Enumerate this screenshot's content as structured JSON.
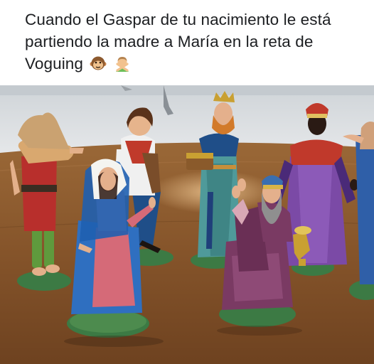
{
  "post": {
    "caption": "Cuando el Gaspar de tu nacimiento le está partiendo la madre a María en la reta de Voguing",
    "caption_emojis": [
      "monkey-face-emoji",
      "man-gesturing-no-emoji"
    ]
  },
  "photo": {
    "subject": "nativity-figurines",
    "figures": [
      "shepherd-with-lamb",
      "shepherd-boy",
      "virgin-mary",
      "king-melchior",
      "king-gaspar",
      "king-baltasar"
    ]
  },
  "colors": {
    "caption_text": "#1c1e21",
    "table": "#8a5a2e",
    "floor": "#d9dde0",
    "mary_cloak": "#2f6fc0",
    "kneeling_king_robe": "#7a3a63",
    "king_teal_robe": "#4f9a9a",
    "king_purple_robe": "#7b4aa6"
  }
}
